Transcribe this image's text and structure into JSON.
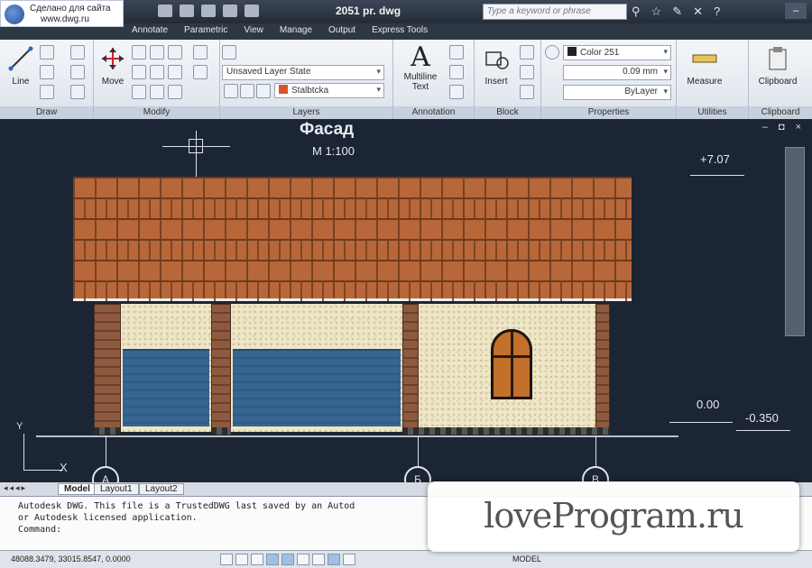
{
  "watermark_site": {
    "line1": "Сделано для сайта",
    "line2": "www.dwg.ru"
  },
  "title_bar": {
    "document_title": "2051 pr. dwg",
    "search_placeholder": "Type a keyword or phrase"
  },
  "ribbon_tabs": [
    "Annotate",
    "Parametric",
    "View",
    "Manage",
    "Output",
    "Express Tools"
  ],
  "panels": {
    "draw": {
      "label": "Draw",
      "line_label": "Line"
    },
    "modify": {
      "label": "Modify",
      "move_label": "Move"
    },
    "layers": {
      "label": "Layers",
      "layer_state": "Unsaved Layer State",
      "current_layer": "Stalbtcka"
    },
    "annotation": {
      "label": "Annotation",
      "mtext_label_1": "Multiline",
      "mtext_label_2": "Text"
    },
    "block": {
      "label": "Block",
      "insert_label": "Insert"
    },
    "properties": {
      "label": "Properties",
      "color": "Color 251",
      "lineweight": "0.09 mm",
      "linetype": "ByLayer"
    },
    "utilities": {
      "label": "Utilities",
      "measure_label": "Measure"
    },
    "clipboard": {
      "label": "Clipboard",
      "clipboard_label": "Clipboard"
    }
  },
  "canvas_controls": [
    "–",
    "◘",
    "×"
  ],
  "drawing": {
    "title": "Фасад",
    "scale": "М 1:100",
    "levels": {
      "top": "+7.07",
      "zero": "0.00",
      "below": "-0.350"
    },
    "axes": [
      "А",
      "Б",
      "В"
    ],
    "ucs": {
      "x": "X",
      "y": "Y"
    }
  },
  "layout_tabs": {
    "nav": "◂◂◂▸",
    "tabs": [
      "Model",
      "Layout1",
      "Layout2"
    ],
    "active": "Model"
  },
  "command_line": {
    "line1": "Autodesk DWG.  This file is a TrustedDWG last saved by an Autod",
    "line2": "or Autodesk licensed application.",
    "prompt": "Command:"
  },
  "status_bar": {
    "coords": "48088.3479, 33015.8547, 0.0000",
    "model": "MODEL"
  },
  "watermark": "loveProgram.ru",
  "colors": {
    "canvas_bg": "#1b2534",
    "roof": "#b7673a",
    "door": "#2d5b88",
    "stucco": "#eee6c6"
  }
}
